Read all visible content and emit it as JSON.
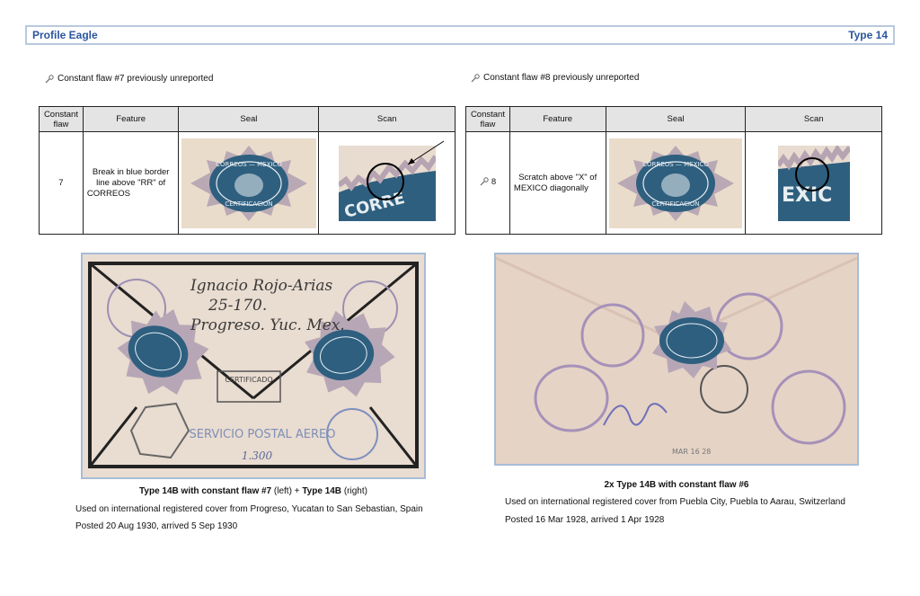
{
  "header": {
    "left": "Profile Eagle",
    "right": "Type 14"
  },
  "left": {
    "section_title": "Constant flaw #7 previously unreported",
    "columns": [
      "Constant flaw",
      "Feature",
      "Seal",
      "Scan"
    ],
    "row": {
      "number": "7",
      "feature": "Break in blue border line above \"RR\" of CORREOS"
    },
    "seal_text": {
      "top": "CORREOS — MEXICO",
      "bottom": "CERTIFICACION"
    },
    "scan_text": "CORRE",
    "cover_handwriting": [
      "Ignacio Rojo-Arias",
      "25-170.",
      "Progreso. Yuc. Mex."
    ],
    "cover_stamps": {
      "registered": "CERTIFICADO",
      "service": "SERVICIO POSTAL AEREO",
      "note": "1.300"
    },
    "caption_title_a": "Type 14B with constant flaw #7",
    "caption_title_b": "(left) + ",
    "caption_title_c": "Type 14B",
    "caption_title_d": "(right)",
    "caption_line1": "Used on international registered cover from Progreso, Yucatan to San Sebastian, Spain",
    "caption_line2": "Posted 20 Aug 1930, arrived 5 Sep 1930"
  },
  "right": {
    "section_title": "Constant flaw #8 previously unreported",
    "columns": [
      "Constant flaw",
      "Feature",
      "Seal",
      "Scan"
    ],
    "row": {
      "number": "8",
      "feature": "Scratch above \"X\" of MEXICO diagonally"
    },
    "seal_text": {
      "top": "CORREOS — MEXICO",
      "bottom": "CERTIFICACION"
    },
    "scan_text": "EXIC",
    "cover_note": "MAR 16 28",
    "caption_title": "2x Type 14B with constant flaw #6",
    "caption_line1": "Used on international registered cover from Puebla City, Puebla to Aarau, Switzerland",
    "caption_line2": "Posted 16 Mar 1928, arrived 1 Apr 1928"
  },
  "colors": {
    "header_text": "#2a55a0",
    "header_border": "#b9c9de",
    "seal_blue": "#2f5f7f",
    "paper": "#efe4d7"
  }
}
